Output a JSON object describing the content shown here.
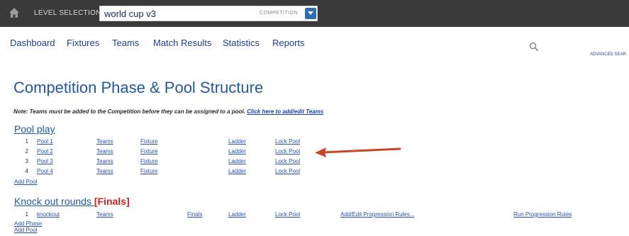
{
  "topbar": {
    "level_label": "LEVEL SELECTION",
    "search_value": "world cup v3",
    "competition_tag": "COMPETITION"
  },
  "nav": {
    "items": [
      {
        "label": "Dashboard"
      },
      {
        "label": "Fixtures"
      },
      {
        "label": "Teams"
      },
      {
        "label": "Match Results"
      },
      {
        "label": "Statistics"
      },
      {
        "label": "Reports"
      }
    ],
    "advanced_search": "ADVANCED SEAR"
  },
  "page": {
    "title": "Competition Phase & Pool Structure",
    "note_prefix": "Note: Teams must be added to the Competition before they can be assigned to a pool.",
    "note_link": "Click here to add/edit Teams"
  },
  "pool_play": {
    "title": "Pool play",
    "rows": [
      {
        "num": "1",
        "name": "Pool 1",
        "teams": "Teams",
        "fixture": "Fixture",
        "ladder": "Ladder",
        "lock": "Lock Pool"
      },
      {
        "num": "2",
        "name": "Pool 2",
        "teams": "Teams",
        "fixture": "Fixture",
        "ladder": "Ladder",
        "lock": "Lock Pool"
      },
      {
        "num": "3",
        "name": "Pool 3",
        "teams": "Teams",
        "fixture": "Fixture",
        "ladder": "Ladder",
        "lock": "Lock Pool"
      },
      {
        "num": "4",
        "name": "Pool 4",
        "teams": "Teams",
        "fixture": "Fixture",
        "ladder": "Ladder",
        "lock": "Lock Pool"
      }
    ],
    "add_pool": "Add Pool"
  },
  "knockout": {
    "title": "Knock out rounds",
    "finals_tag": "[Finals]",
    "rows": [
      {
        "num": "1",
        "name": "knockout",
        "teams": "Teams",
        "finals": "Finals",
        "ladder": "Ladder",
        "lock": "Lock Pool",
        "progression": "Add/Edit Progression Rules...",
        "run": "Run Progression Rules"
      }
    ],
    "add_phase": "Add Phase",
    "add_pool": "Add Pool"
  },
  "colors": {
    "topbar_bg": "#3a3a3a",
    "link_blue": "#2a50b0",
    "title_blue": "#1f5a9e",
    "finals_red": "#d02020",
    "arrow_red": "#c8462c",
    "dropdown_blue": "#2f6db5"
  },
  "icons": [
    "home-icon",
    "chevron-down-icon",
    "search-icon",
    "arrow-pointer"
  ]
}
